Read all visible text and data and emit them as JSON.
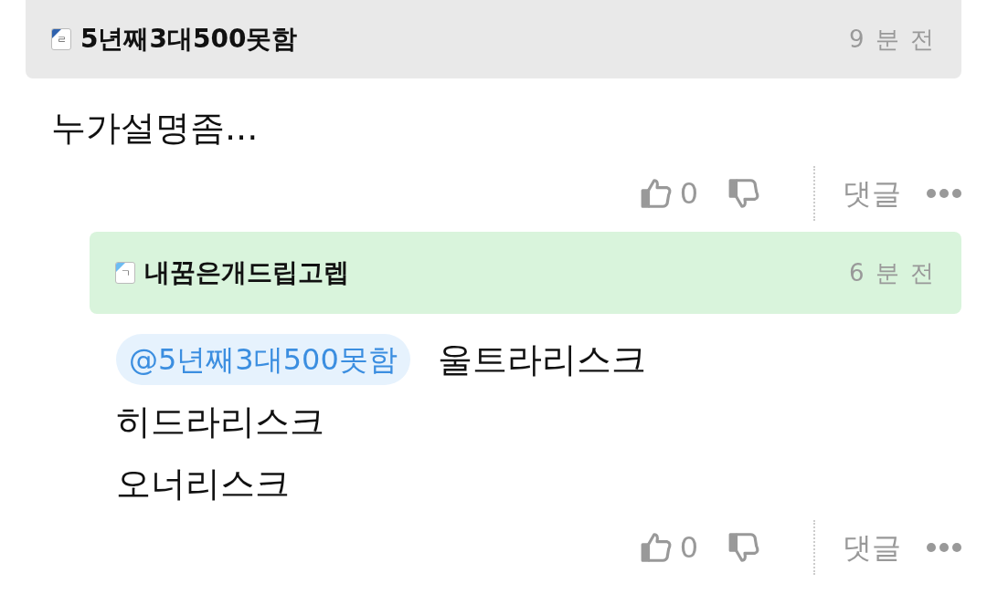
{
  "comments": [
    {
      "author": "5년째3대500못함",
      "level_badge": {
        "text": "ㄹ",
        "color": "#2f62ad"
      },
      "time": "9 분 전",
      "reply": false,
      "lines": [
        "누가설명좀..."
      ],
      "likes": "0",
      "reply_label": "댓글"
    },
    {
      "author": "내꿈은개드립고렙",
      "level_badge": {
        "text": "ㄱ",
        "color": "#6cbcf2"
      },
      "time": "6 분 전",
      "reply": true,
      "mention": "@5년째3대500못함",
      "lines": [
        "울트라리스크",
        "히드라리스크",
        "오너리스크"
      ],
      "likes": "0",
      "reply_label": "댓글"
    }
  ]
}
